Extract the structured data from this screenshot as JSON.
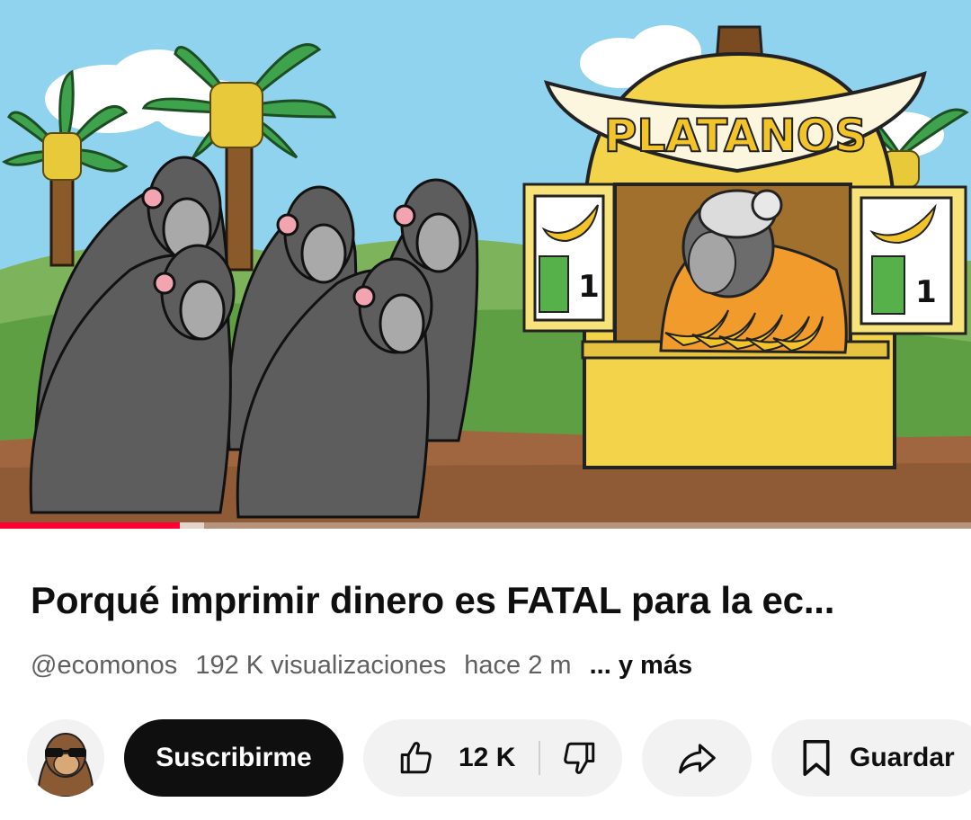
{
  "video": {
    "title": "Porqué imprimir dinero es FATAL para la ec...",
    "channel_handle": "@ecomonos",
    "views": "192 K visualizaciones",
    "age": "hace 2 m",
    "more": "... y más",
    "progress_played": 0.185,
    "progress_buffered": 0.21,
    "thumbnail": {
      "sign_text": "PLATANOS",
      "price_left": "1",
      "price_right": "1"
    }
  },
  "actions": {
    "subscribe_label": "Suscribirme",
    "like_count": "12 K",
    "save_label": "Guardar"
  },
  "icons": {
    "like": "thumbs-up-icon",
    "dislike": "thumbs-down-icon",
    "share": "share-arrow-icon",
    "save": "bookmark-icon"
  },
  "colors": {
    "progress": "#ff0033",
    "subscribe_bg": "#0f0f0f",
    "pill_bg": "#f2f2f2",
    "meta_text": "#606060"
  }
}
